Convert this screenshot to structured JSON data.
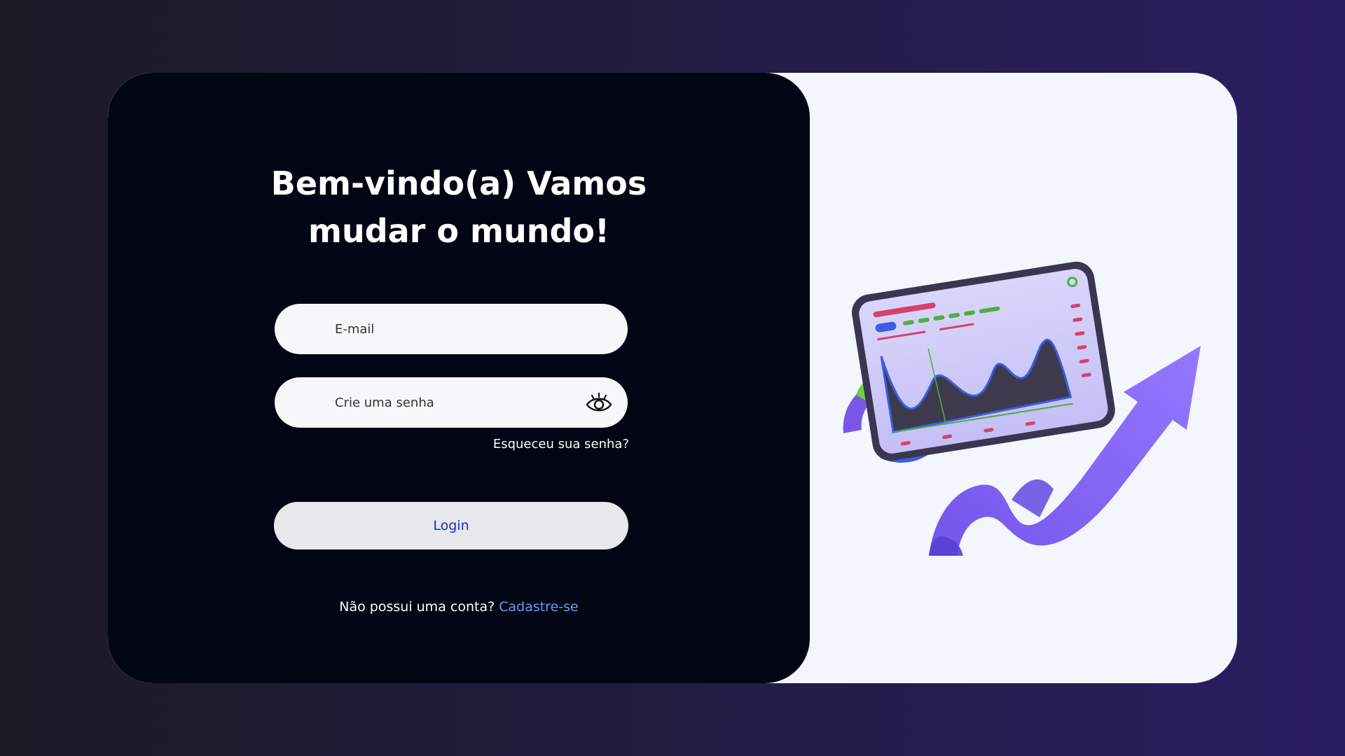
{
  "login": {
    "title_line1": "Bem-vindo(a) Vamos",
    "title_line2": "mudar o mundo!",
    "email_placeholder": "E-mail",
    "password_placeholder": "Crie uma senha",
    "password_toggle_icon": "eye-icon",
    "forgot_password": "Esqueceu sua senha?",
    "login_button": "Login",
    "no_account_text": "Não possui uma conta?",
    "signup_link": "Cadastre-se"
  },
  "illustration": {
    "description_icon": "tablet-chart-arrow-illustration"
  },
  "colors": {
    "background_start": "#1c1a26",
    "background_end": "#2a1e63",
    "panel_dark": "#010514",
    "panel_light": "#f3f6fd",
    "login_text": "#1c2fb5",
    "link": "#6aa0f0",
    "accent_purple": "#7b5cf0"
  }
}
